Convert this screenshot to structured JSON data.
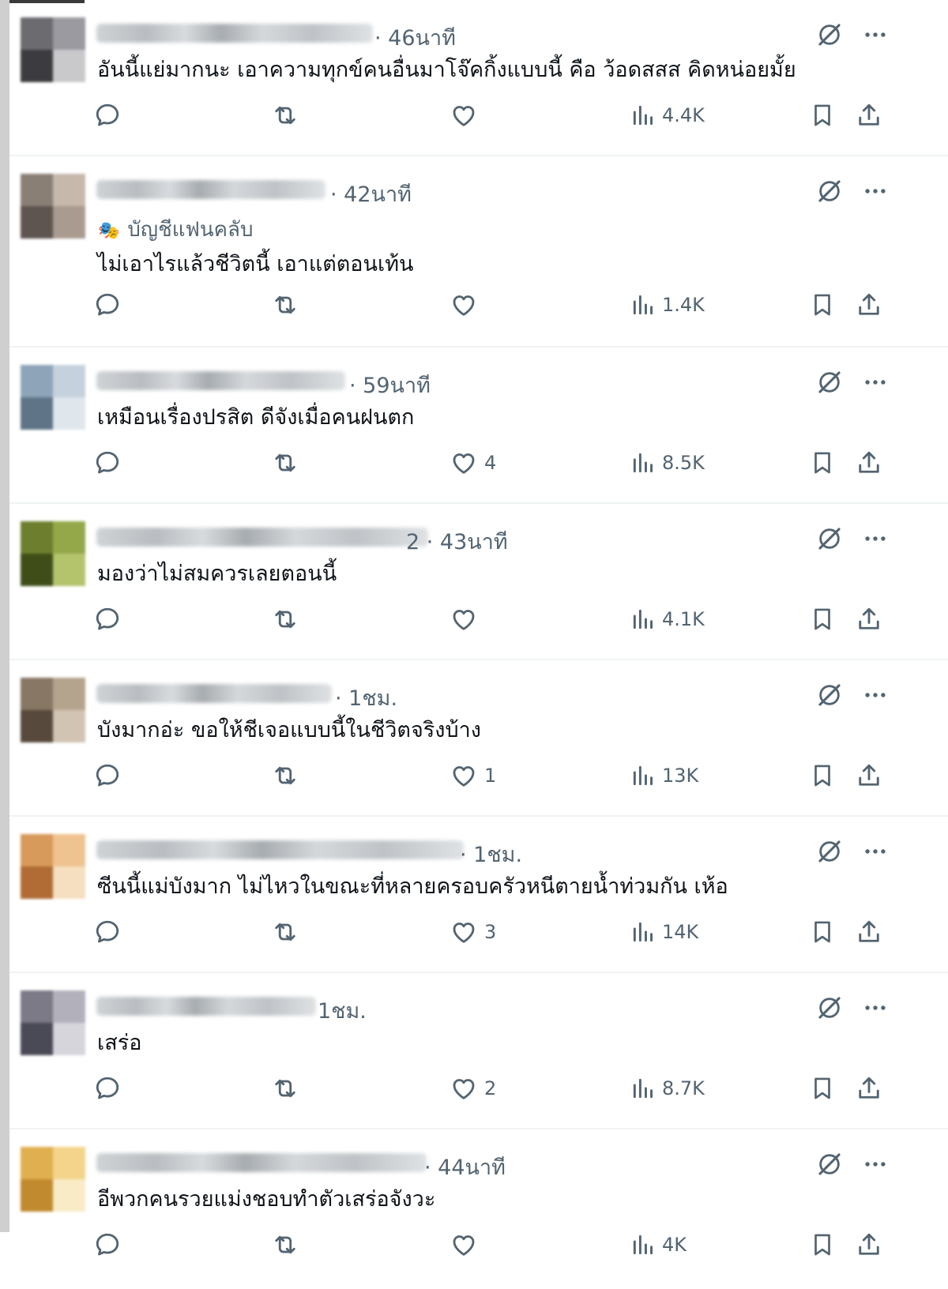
{
  "replies": [
    {
      "time": "· 46นาที",
      "badge": "",
      "text": "อันนี้แย่มากนะ เอาความทุกข์คนอื่นมาโจ๊คกิ้งแบบนี้ คือ ว้อดสสส คิดหน่อยมั้ย",
      "likes": "",
      "views": "4.4K"
    },
    {
      "time": "· 42นาที",
      "badge": "บัญชีแฟนคลับ",
      "text": "ไม่เอาไรแล้วชีวิตนี้ เอาแต่ตอนเท้น",
      "likes": "",
      "views": "1.4K"
    },
    {
      "time": "· 59นาที",
      "badge": "",
      "text": "เหมือนเรื่องปรสิต ดีจังเมื่อคนฝนตก",
      "likes": "4",
      "views": "8.5K"
    },
    {
      "time": "2 · 43นาที",
      "badge": "",
      "text": "มองว่าไม่สมควรเลยตอนนี้",
      "likes": "",
      "views": "4.1K"
    },
    {
      "time": "· 1ชม.",
      "badge": "",
      "text": "บังมากอ่ะ ขอให้ชีเจอแบบนี้ในชีวิตจริงบ้าง",
      "likes": "1",
      "views": "13K"
    },
    {
      "time": "· 1ชม.",
      "badge": "",
      "text": "ซีนนี้แม่บังมาก ไม่ไหวในขณะที่หลายครอบครัวหนีตายน้ำท่วมกัน เห้อ",
      "likes": "3",
      "views": "14K"
    },
    {
      "time": "1ชม.",
      "badge": "",
      "text": "เสร่อ",
      "likes": "2",
      "views": "8.7K"
    },
    {
      "time": "· 44นาที",
      "badge": "",
      "text": "อีพวกคนรวยแม่งชอบทำตัวเสร่อจังวะ",
      "likes": "",
      "views": "4K"
    }
  ]
}
